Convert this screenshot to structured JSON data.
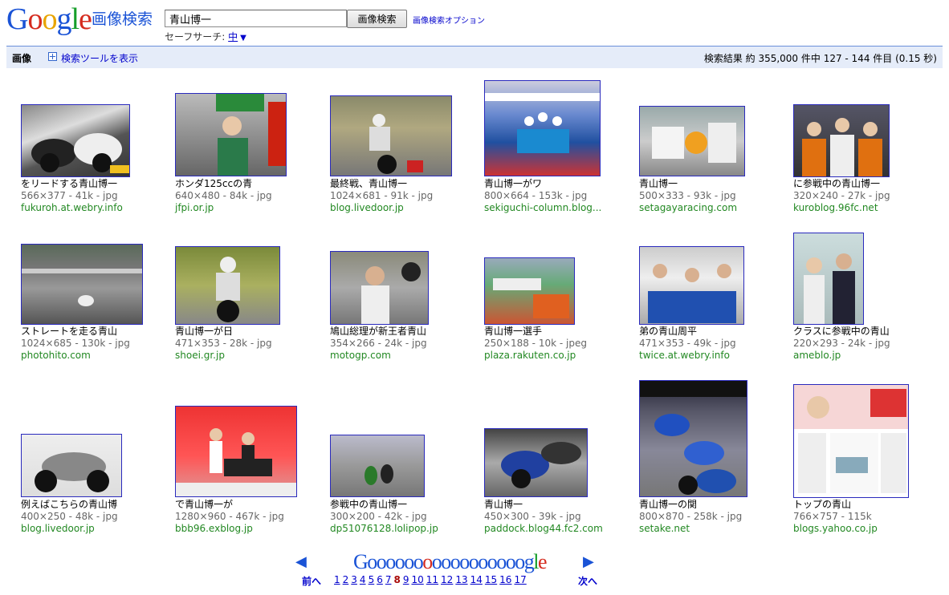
{
  "header": {
    "service": "画像検索",
    "query": "青山博一",
    "search_button": "画像検索",
    "advanced_link": "画像検索オプション",
    "safesearch_label": "セーフサーチ:",
    "safesearch_value": "中"
  },
  "bar": {
    "label": "画像",
    "tools_link": "検索ツールを表示",
    "stats": "検索結果 約 355,000 件中 127 - 144 件目 (0.15 秒)"
  },
  "results": [
    {
      "title": "をリードする青山博一",
      "meta": "566×377 - 41k - jpg",
      "domain": "fukuroh.at.webry.info"
    },
    {
      "title": "ホンダ125ccの青",
      "meta": "640×480 - 84k - jpg",
      "domain": "jfpi.or.jp"
    },
    {
      "title": "最終戦、青山博一",
      "meta": "1024×681 - 91k - jpg",
      "domain": "blog.livedoor.jp"
    },
    {
      "title": "青山博一がワ",
      "meta": "800×664 - 153k - jpg",
      "domain": "sekiguchi-column.blog..."
    },
    {
      "title": "青山博一",
      "meta": "500×333 - 93k - jpg",
      "domain": "setagayaracing.com"
    },
    {
      "title": "に参戦中の青山博一",
      "meta": "320×240 - 27k - jpg",
      "domain": "kuroblog.96fc.net"
    },
    {
      "title": "ストレートを走る青山",
      "meta": "1024×685 - 130k - jpg",
      "domain": "photohito.com"
    },
    {
      "title": "青山博一が日",
      "meta": "471×353 - 28k - jpg",
      "domain": "shoei.gr.jp"
    },
    {
      "title": "鳩山総理が新王者青山",
      "meta": "354×266 - 24k - jpg",
      "domain": "motogp.com"
    },
    {
      "title": "青山博一選手",
      "meta": "250×188 - 10k - jpeg",
      "domain": "plaza.rakuten.co.jp"
    },
    {
      "title": "弟の青山周平",
      "meta": "471×353 - 49k - jpg",
      "domain": "twice.at.webry.info"
    },
    {
      "title": "クラスに参戦中の青山",
      "meta": "220×293 - 24k - jpg",
      "domain": "ameblo.jp"
    },
    {
      "title": "例えばこちらの青山博",
      "meta": "400×250 - 48k - jpg",
      "domain": "blog.livedoor.jp"
    },
    {
      "title": "で青山博一が",
      "meta": "1280×960 - 467k - jpg",
      "domain": "bbb96.exblog.jp"
    },
    {
      "title": "参戦中の青山博一",
      "meta": "300×200 - 42k - jpg",
      "domain": "dp51076128.lolipop.jp"
    },
    {
      "title": "青山博一",
      "meta": "450×300 - 39k - jpg",
      "domain": "paddock.blog44.fc2.com"
    },
    {
      "title": "青山博一の関",
      "meta": "800×870 - 258k - jpg",
      "domain": "setake.net"
    },
    {
      "title": "トップの青山",
      "meta": "766×757 - 115k",
      "domain": "blogs.yahoo.co.jp"
    }
  ],
  "pager": {
    "prev": "前へ",
    "next": "次へ",
    "pages": [
      "1",
      "2",
      "3",
      "4",
      "5",
      "6",
      "7",
      "8",
      "9",
      "10",
      "11",
      "12",
      "13",
      "14",
      "15",
      "16",
      "17"
    ],
    "current": "8"
  },
  "colors": {
    "accent": "#1a53d6",
    "bar_bg": "#e5ecf9",
    "domain_green": "#228822",
    "meta_gray": "#666666",
    "current_page": "#a90a08"
  }
}
